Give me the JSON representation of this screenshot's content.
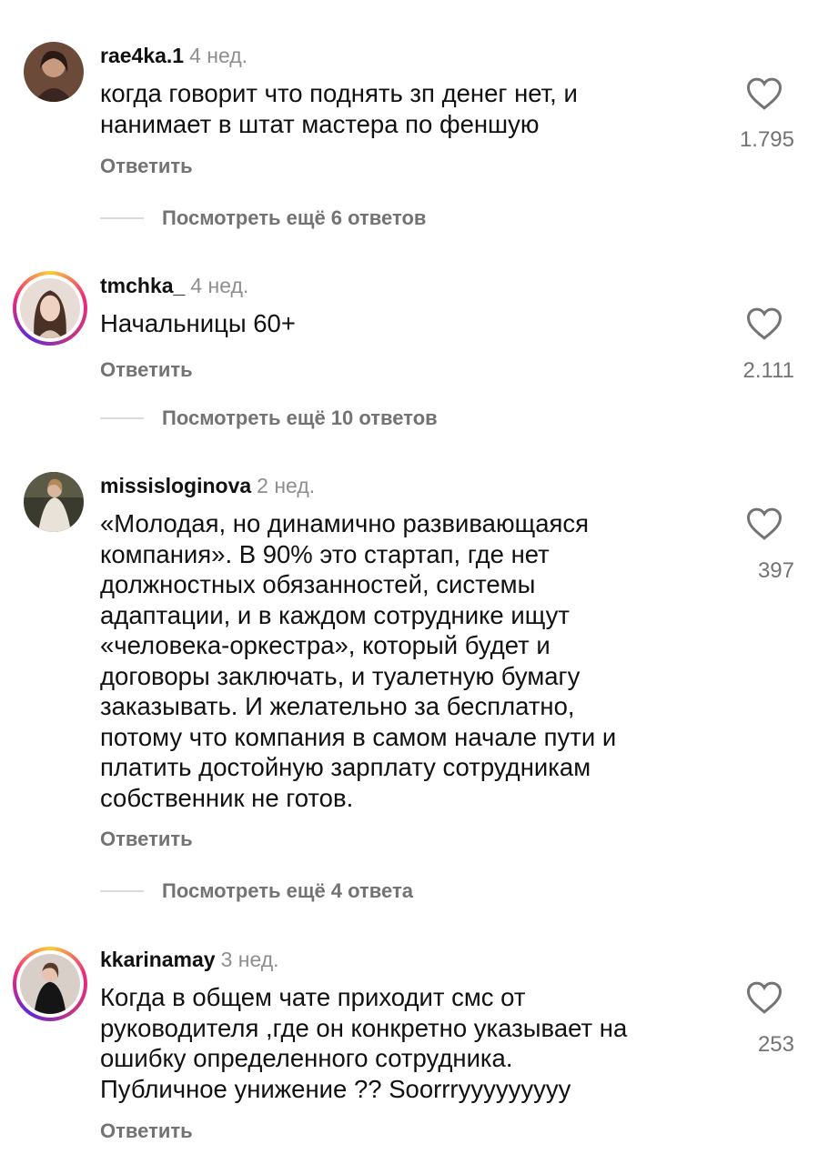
{
  "comments": [
    {
      "username": "rae4ka.1",
      "time": "4 нед.",
      "text": "когда говорит что поднять зп денег нет, и\nнанимает в штат мастера по феншую",
      "reply_label": "Ответить",
      "likes": "1.795",
      "view_replies": "Посмотреть ещё 6 ответов"
    },
    {
      "username": "tmchka_",
      "time": "4 нед.",
      "text": "Начальницы 60+",
      "reply_label": "Ответить",
      "likes": "2.111",
      "view_replies": "Посмотреть ещё 10 ответов"
    },
    {
      "username": "missisloginova",
      "time": "2 нед.",
      "text": "«Молодая, но динамично развивающаяся\nкомпания». В 90% это стартап, где нет\nдолжностных обязанностей, системы\nадаптации, и в каждом сотруднике ищут\n«человека-оркестра», который будет и\nдоговоры заключать, и туалетную бумагу\nзаказывать. И желательно за бесплатно,\nпотому что компания в самом начале пути и\nплатить достойную зарплату сотрудникам\nсобственник не готов.",
      "reply_label": "Ответить",
      "likes": "397",
      "view_replies": "Посмотреть ещё 4 ответа"
    },
    {
      "username": "kkarinamay",
      "time": "3 нед.",
      "text": "Когда в общем чате приходит смс от\nруководителя ,где он конкретно указывает на\nошибку определенного сотрудника.\nПубличное унижение ?? Soorrryyyyyyyyy",
      "reply_label": "Ответить",
      "likes": "253"
    }
  ],
  "colors": {
    "text": "#111111",
    "secondary": "#737373",
    "time": "#8e8e8e",
    "divider": "#dbdbdb"
  },
  "icons": {
    "like": "heart-outline-icon"
  }
}
